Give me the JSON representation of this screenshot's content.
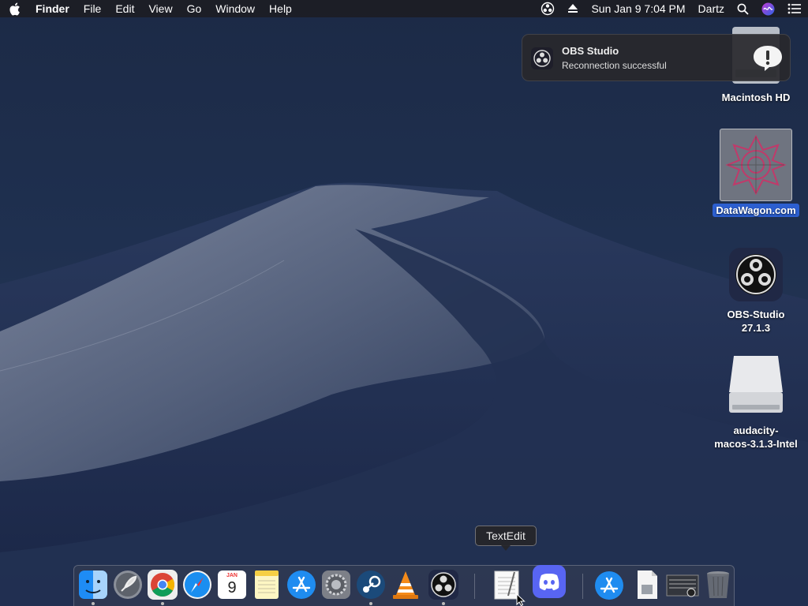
{
  "menubar": {
    "apple": "apple-logo-icon",
    "app_name": "Finder",
    "items": [
      "File",
      "Edit",
      "View",
      "Go",
      "Window",
      "Help"
    ],
    "right": {
      "date_time": "Sun Jan 9  7:04 PM",
      "user": "Dartz"
    }
  },
  "notification": {
    "title": "OBS Studio",
    "message": "Reconnection successful"
  },
  "desktop_icons": {
    "hd": "Macintosh HD",
    "datawagon": "DataWagon.com",
    "obs_line1": "OBS-Studio",
    "obs_line2": "27.1.3",
    "audacity_line1": "audacity-",
    "audacity_line2": "macos-3.1.3-Intel"
  },
  "tooltip": "TextEdit",
  "dock": {
    "calendar_month": "JAN",
    "calendar_day": "9",
    "items": [
      "Finder",
      "Launchpad",
      "Google Chrome",
      "Safari",
      "Calendar",
      "Notes",
      "App Store",
      "System Preferences",
      "Steam",
      "VLC",
      "OBS",
      "TextEdit",
      "Discord",
      "Applications",
      "Document",
      "Screen Recording",
      "Trash"
    ]
  },
  "colors": {
    "selection": "#2c5fd0",
    "discord": "#5865f2",
    "app_store": "#1f8cf0"
  }
}
